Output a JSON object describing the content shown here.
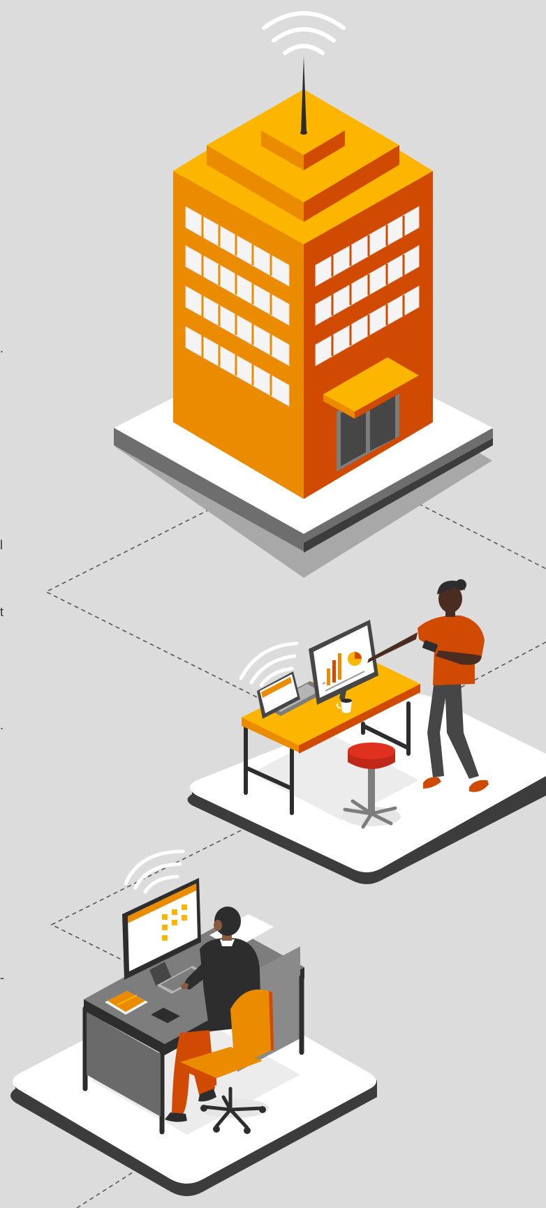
{
  "illustration": {
    "edge_glyphs": [
      ".",
      "l",
      "t",
      ".",
      "-"
    ],
    "colors": {
      "background": "#dcdcdc",
      "orange_light": "#fdb600",
      "orange_mid": "#eb8c00",
      "orange_dark": "#d04a02",
      "red": "#e0301e",
      "dark": "#2d2d2d",
      "gray_dark": "#464646",
      "gray_mid": "#7d7d7d",
      "white": "#ffffff"
    },
    "icons": [
      "wifi-icon",
      "bar-chart-icon",
      "pie-chart-icon",
      "coffee-cup-icon",
      "smartphone-icon",
      "keyboard-icon"
    ]
  }
}
